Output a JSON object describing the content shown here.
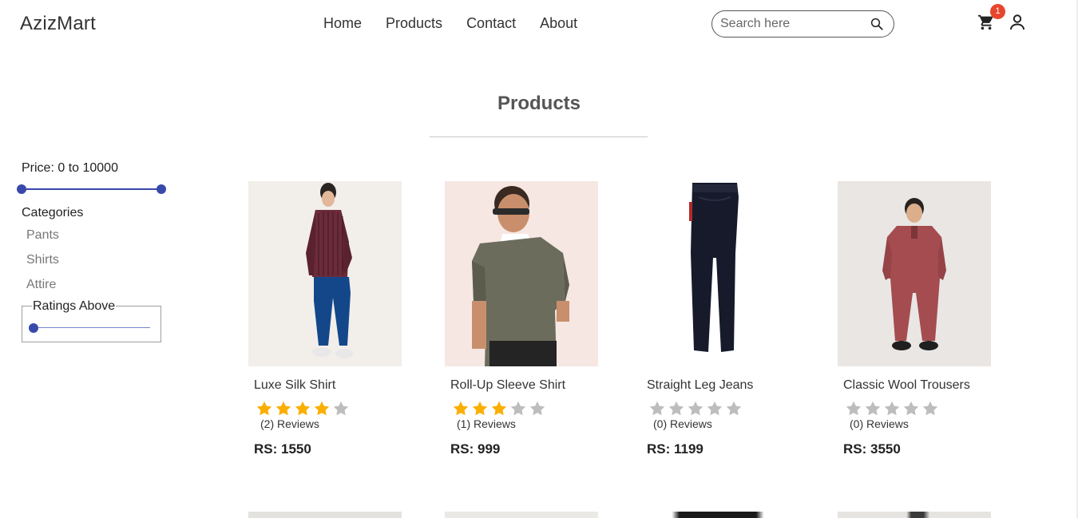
{
  "brand": "AzizMart",
  "nav": {
    "home": "Home",
    "products": "Products",
    "contact": "Contact",
    "about": "About"
  },
  "search": {
    "placeholder": "Search here",
    "value": ""
  },
  "cart": {
    "count": "1"
  },
  "page_title": "Products",
  "filters": {
    "price_label": "Price: 0 to 10000",
    "price_min": 0,
    "price_max": 10000,
    "categories_label": "Categories",
    "categories": [
      "Pants",
      "Shirts",
      "Attire"
    ],
    "ratings_label": "Ratings Above",
    "ratings_value": 0
  },
  "products": [
    {
      "name": "Luxe Silk Shirt",
      "rating": 4,
      "reviews": "(2) Reviews",
      "price": "RS: 1550"
    },
    {
      "name": "Roll-Up Sleeve Shirt",
      "rating": 3,
      "reviews": "(1) Reviews",
      "price": "RS: 999"
    },
    {
      "name": "Straight Leg Jeans",
      "rating": 0,
      "reviews": "(0) Reviews",
      "price": "RS: 1199"
    },
    {
      "name": "Classic Wool Trousers",
      "rating": 0,
      "reviews": "(0) Reviews",
      "price": "RS: 3550"
    }
  ],
  "colors": {
    "accent": "#3949ab",
    "star_filled": "#faaf00",
    "star_empty": "#bdbdbd",
    "badge": "#e8462c"
  }
}
